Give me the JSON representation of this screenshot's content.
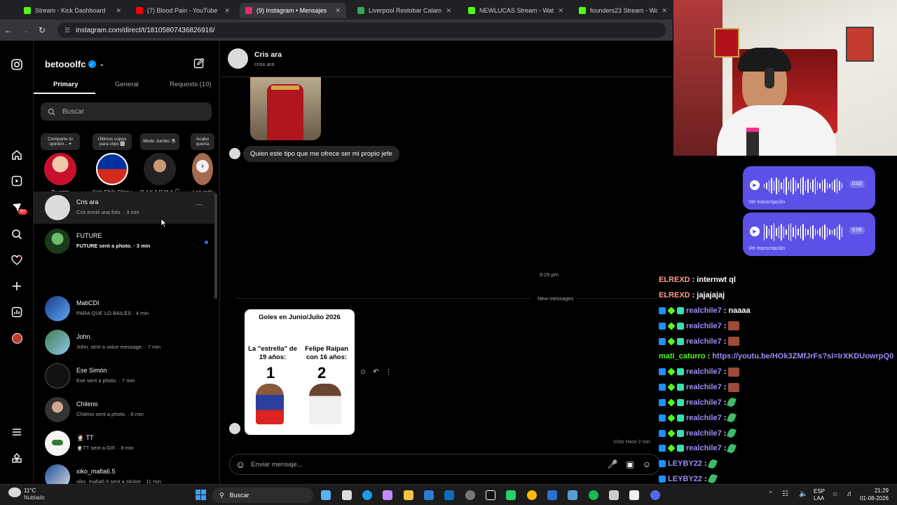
{
  "browser": {
    "tabs": [
      {
        "label": "Stream - Kick Dashboard",
        "color": "#53fc18",
        "active": false
      },
      {
        "label": "(7) Blood Pain - YouTube",
        "color": "#ff0000",
        "active": false
      },
      {
        "label": "(9) Instagram • Mensajes",
        "color": "#e1306c",
        "active": true
      },
      {
        "label": "Liverpool Restobar Calama - Go",
        "color": "#34a853",
        "active": false
      },
      {
        "label": "NEWLUCAS Stream - Watch Li",
        "color": "#53fc18",
        "active": false
      },
      {
        "label": "founders23 Stream - Watch Liv",
        "color": "#53fc18",
        "active": false
      }
    ],
    "url": "instagram.com/direct/t/18105807436826916/"
  },
  "rail": {
    "badge": "9+"
  },
  "inbox": {
    "account": "betooolfc",
    "tabs": {
      "primary": "Primary",
      "general": "General",
      "requests": "Requests (10)"
    },
    "search_placeholder": "Buscar",
    "notes": [
      {
        "bubble": "Comparte tu opinión... ▾",
        "name": "Tu nota"
      },
      {
        "bubble": "Últimos cupos para clips 🅾",
        "name": "Kick Chile Clips cl"
      },
      {
        "bubble": "Modo Jumbo 🚇",
        "name": "D J K A R M A 🎧"
      },
      {
        "bubble": "Acabo quería",
        "name": "Leo rodr"
      }
    ],
    "conversations": [
      {
        "name": "Cris ara",
        "preview": "Cris envió una foto. · 3 min",
        "unread": false
      },
      {
        "name": "FUTURE",
        "preview": "FUTURE sent a photo. · 3 min",
        "unread": true
      },
      {
        "name": "MatiCDI",
        "preview": "PARA QUE LO BAILES · 4 min",
        "unread": false
      },
      {
        "name": "John.",
        "preview": "John. sent a voice message. · 7 min",
        "unread": false
      },
      {
        "name": "Ese Simón",
        "preview": "Ese sent a photo. · 7 min",
        "unread": false
      },
      {
        "name": "Chileno",
        "preview": "Chileno sent a photo. · 8 min",
        "unread": false
      },
      {
        "name": "🤵🏻 TT",
        "preview": "🤵🏻TT sent a GIF. · 8 min",
        "unread": false
      },
      {
        "name": "xiko_mafia6.5",
        "preview": "xiko_mafia6.5 sent a sticker · 11 min",
        "unread": false
      }
    ]
  },
  "chat": {
    "name": "Cris ara",
    "username": "crisx.ara",
    "message1": "Quien este tipo que me ofrece ser mi propio jefe",
    "time": "9:25 pm",
    "new_messages": "New messages",
    "card": {
      "title": "Goles en Junio/Julio 2026",
      "left_label": "La \"estrella\" de 19 años:",
      "left_value": "1",
      "right_label": "Felipe Raipan con 16 años:",
      "right_value": "2"
    },
    "seen": "Visto Hace 2 min",
    "composer_placeholder": "Enviar mensaje..."
  },
  "voice_messages": [
    {
      "duration": "0:03",
      "transcript": "Ver transcripción"
    },
    {
      "duration": "0:05",
      "transcript": "Ver transcripción"
    }
  ],
  "stream_chat": [
    {
      "user": "ELREXD",
      "text": "internwt ql",
      "style": "o",
      "badges": false,
      "kind": "text"
    },
    {
      "user": "ELREXD",
      "text": "jajajajaj",
      "style": "o",
      "badges": false,
      "kind": "text"
    },
    {
      "user": "realchile7",
      "text": "naaaa",
      "style": "p",
      "badges": true,
      "kind": "text"
    },
    {
      "user": "realchile7",
      "text": "",
      "style": "p",
      "badges": true,
      "kind": "emote"
    },
    {
      "user": "realchile7",
      "text": "",
      "style": "p",
      "badges": true,
      "kind": "emote"
    },
    {
      "user": "mati_caturro",
      "text": "https://youtu.be/HOk3ZMfJrFs?si=IrXKDUowrpQ0",
      "style": "g",
      "badges": false,
      "kind": "link"
    },
    {
      "user": "realchile7",
      "text": "",
      "style": "p",
      "badges": true,
      "kind": "emote"
    },
    {
      "user": "realchile7",
      "text": "",
      "style": "p",
      "badges": true,
      "kind": "emote"
    },
    {
      "user": "realchile7",
      "text": "",
      "style": "p",
      "badges": true,
      "kind": "leaf"
    },
    {
      "user": "realchile7",
      "text": "",
      "style": "p",
      "badges": true,
      "kind": "leaf"
    },
    {
      "user": "realchile7",
      "text": "",
      "style": "p",
      "badges": true,
      "kind": "leaf"
    },
    {
      "user": "realchile7",
      "text": "",
      "style": "p",
      "badges": true,
      "kind": "leaf"
    },
    {
      "user": "LEYBY22",
      "text": "",
      "style": "p",
      "badges": false,
      "kind": "leaf"
    },
    {
      "user": "LEYBY22",
      "text": "",
      "style": "p",
      "badges": false,
      "kind": "leaf"
    },
    {
      "user": "LEYBY22",
      "text": "",
      "style": "p",
      "badges": false,
      "kind": "leaf"
    }
  ],
  "taskbar": {
    "weather_temp": "11°C",
    "weather_desc": "Nublado",
    "search": "Buscar",
    "lang": "ESP",
    "lang2": "LAA",
    "time": "21:29",
    "date": "01-08-2026"
  }
}
